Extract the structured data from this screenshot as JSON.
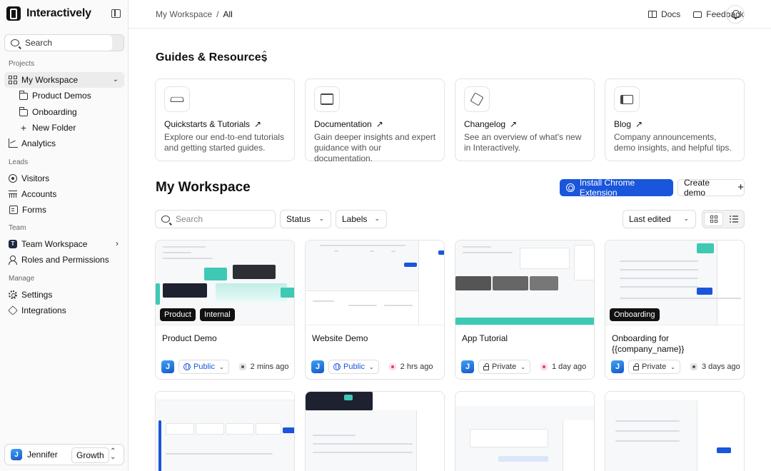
{
  "app": {
    "name": "Interactively"
  },
  "sidebar": {
    "search_label": "Search",
    "sections": {
      "projects": "Projects",
      "leads": "Leads",
      "team": "Team",
      "manage": "Manage"
    },
    "workspace": "My Workspace",
    "folders": [
      "Product Demos",
      "Onboarding"
    ],
    "new_folder": "New Folder",
    "analytics": "Analytics",
    "leads_items": [
      "Visitors",
      "Accounts",
      "Forms"
    ],
    "team_workspace": "Team Workspace",
    "team_initial": "T",
    "roles": "Roles and Permissions",
    "settings": "Settings",
    "integrations": "Integrations",
    "user": {
      "initial": "J",
      "name": "Jennifer",
      "plan": "Growth"
    }
  },
  "header": {
    "breadcrumb": [
      "My Workspace",
      "/",
      "All"
    ],
    "docs": "Docs",
    "feedback": "Feedback"
  },
  "guides": {
    "title": "Guides & Resources",
    "cards": [
      {
        "title": "Quickstarts & Tutorials",
        "desc": "Explore our end-to-end tutorials and getting started guides.",
        "icon": "graduation-cap-icon"
      },
      {
        "title": "Documentation",
        "desc": "Gain deeper insights and expert guidance with our documentation.",
        "icon": "books-icon"
      },
      {
        "title": "Changelog",
        "desc": "See an overview of what's new in Interactively.",
        "icon": "box-icon"
      },
      {
        "title": "Blog",
        "desc": "Company announcements, demo insights, and helpful tips.",
        "icon": "newspaper-icon"
      }
    ]
  },
  "workspace": {
    "title": "My Workspace",
    "chrome_button": "Install Chrome Extension",
    "create_button": "Create demo",
    "search_placeholder": "Search",
    "status_filter": "Status",
    "labels_filter": "Labels",
    "sort": "Last edited"
  },
  "demos": [
    {
      "name": "Product Demo",
      "tags": [
        "Product",
        "Internal"
      ],
      "visibility": "Public",
      "time": "2 mins ago",
      "owner_initial": "J",
      "time_color": "#555555"
    },
    {
      "name": "Website Demo",
      "tags": [],
      "visibility": "Public",
      "time": "2 hrs ago",
      "owner_initial": "J",
      "time_color": "#e63b6e"
    },
    {
      "name": "App Tutorial",
      "tags": [],
      "visibility": "Private",
      "time": "1 day ago",
      "owner_initial": "J",
      "time_color": "#e63b6e"
    },
    {
      "name": "Onboarding for {{company_name}}",
      "tags": [
        "Onboarding"
      ],
      "visibility": "Private",
      "time": "3 days ago",
      "owner_initial": "J",
      "time_color": "#555555"
    }
  ],
  "colors": {
    "accent": "#1a56db",
    "teal": "#3ec9b4",
    "dark": "#111111"
  }
}
